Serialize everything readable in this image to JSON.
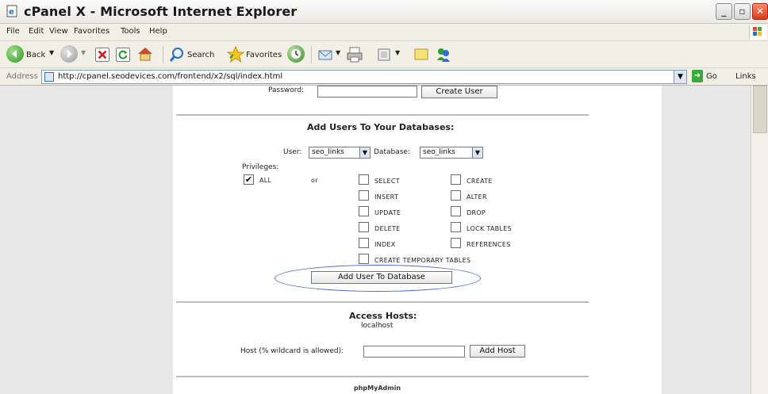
{
  "window": {
    "title": "cPanel X - Microsoft Internet Explorer"
  },
  "menu": {
    "items": [
      "File",
      "Edit",
      "View",
      "Favorites",
      "Tools",
      "Help"
    ]
  },
  "toolbar": {
    "back_label": "Back",
    "search_label": "Search",
    "favorites_label": "Favorites"
  },
  "address_bar": {
    "label": "Address",
    "url": "http://cpanel.seodevices.com/frontend/x2/sql/index.html",
    "go_label": "Go",
    "links_label": "Links"
  },
  "content": {
    "password_label": "Password:",
    "create_user_label": "Create User",
    "add_users_title": "Add Users To Your Databases:",
    "user_label": "User:",
    "user_selected": "seo_links",
    "database_label": "Database:",
    "database_selected": "seo_links",
    "privileges_label": "Privileges:",
    "all_label": "ALL",
    "all_checked": true,
    "or_label": "or",
    "privileges_left": [
      "SELECT",
      "INSERT",
      "UPDATE",
      "DELETE",
      "INDEX"
    ],
    "privileges_right": [
      "CREATE",
      "ALTER",
      "DROP",
      "LOCK TABLES",
      "REFERENCES"
    ],
    "create_temp_label": "CREATE TEMPORARY TABLES",
    "add_user_db_button": "Add User To Database",
    "access_hosts_title": "Access Hosts:",
    "localhost": "localhost",
    "host_label": "Host (% wildcard is allowed):",
    "add_host_button": "Add Host",
    "phpmyadmin_link": "phpMyAdmin"
  },
  "colors": {
    "side_band": "#e7e7e7",
    "annotation_ellipse": "#4f66d6",
    "chrome": "#f1efe6"
  }
}
